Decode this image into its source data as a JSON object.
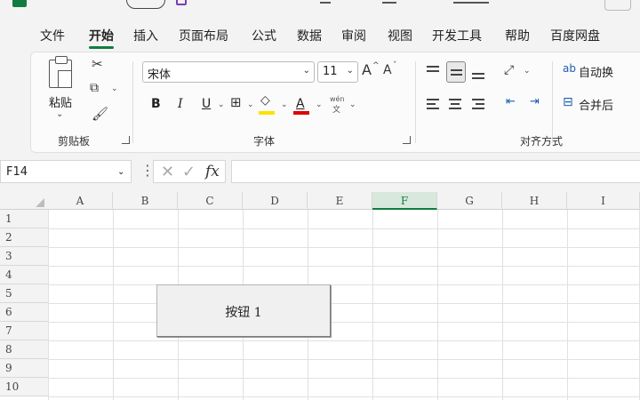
{
  "menu": {
    "tabs": [
      {
        "label": "文件"
      },
      {
        "label": "开始"
      },
      {
        "label": "插入"
      },
      {
        "label": "页面布局"
      },
      {
        "label": "公式"
      },
      {
        "label": "数据"
      },
      {
        "label": "审阅"
      },
      {
        "label": "视图"
      },
      {
        "label": "开发工具"
      },
      {
        "label": "帮助"
      },
      {
        "label": "百度网盘"
      }
    ],
    "active_tab": "开始"
  },
  "ribbon": {
    "clipboard": {
      "label": "剪贴板",
      "paste_label": "粘贴"
    },
    "font": {
      "label": "字体",
      "font_name": "宋体",
      "font_size": "11",
      "bold": "B",
      "italic": "I",
      "underline": "U",
      "grow": "A",
      "shrink": "A",
      "phonetic_top": "wén",
      "phonetic_bottom": "文"
    },
    "alignment": {
      "label": "对齐方式",
      "wrap_label": "自动换",
      "merge_label": "合并后"
    }
  },
  "formula_bar": {
    "name_box": "F14",
    "fx_label": "fx",
    "formula": ""
  },
  "sheet": {
    "columns": [
      "A",
      "B",
      "C",
      "D",
      "E",
      "F",
      "G",
      "H",
      "I"
    ],
    "selected_column": "F",
    "rows": [
      "1",
      "2",
      "3",
      "4",
      "5",
      "6",
      "7",
      "8",
      "9",
      "10"
    ],
    "form_button": {
      "label": "按钮 1"
    }
  },
  "colors": {
    "accent": "#107c41",
    "highlight": "#ffe000",
    "font_color": "#e00000"
  },
  "icons": [
    "excel-logo-icon",
    "cut-icon",
    "copy-icon",
    "format-painter-icon",
    "border-icon",
    "fill-color-icon",
    "font-color-icon",
    "orientation-icon",
    "wrap-text-icon",
    "merge-icon",
    "cancel-icon",
    "enter-icon",
    "fx-icon"
  ]
}
